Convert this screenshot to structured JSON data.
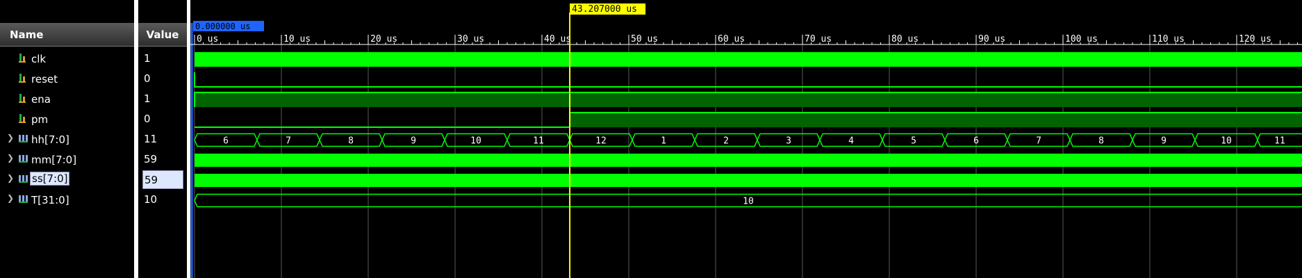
{
  "header": {
    "name": "Name",
    "value": "Value"
  },
  "signals": [
    {
      "name": "clk",
      "value": "1",
      "bus": false,
      "expandable": false,
      "selected": false
    },
    {
      "name": "reset",
      "value": "0",
      "bus": false,
      "expandable": false,
      "selected": false
    },
    {
      "name": "ena",
      "value": "1",
      "bus": false,
      "expandable": false,
      "selected": false
    },
    {
      "name": "pm",
      "value": "0",
      "bus": false,
      "expandable": false,
      "selected": false
    },
    {
      "name": "hh[7:0]",
      "value": "11",
      "bus": true,
      "expandable": true,
      "selected": false
    },
    {
      "name": "mm[7:0]",
      "value": "59",
      "bus": true,
      "expandable": true,
      "selected": false
    },
    {
      "name": "ss[7:0]",
      "value": "59",
      "bus": true,
      "expandable": true,
      "selected": true
    },
    {
      "name": "T[31:0]",
      "value": "10",
      "bus": true,
      "expandable": true,
      "selected": false
    }
  ],
  "cursor": {
    "label": "43.207000 us",
    "time_us": 43.207
  },
  "start_marker": {
    "label": "0.000000 us"
  },
  "timeline": {
    "start_us": 0,
    "end_us": 127.5,
    "major_step_us": 10,
    "ticks": [
      "0 us",
      "10 us",
      "20 us",
      "30 us",
      "40 us",
      "50 us",
      "60 us",
      "70 us",
      "80 us",
      "90 us",
      "100 us",
      "110 us",
      "120 us"
    ]
  },
  "hh_segments": [
    {
      "value": "6",
      "start_us": 0,
      "end_us": 7.2
    },
    {
      "value": "7",
      "start_us": 7.2,
      "end_us": 14.4
    },
    {
      "value": "8",
      "start_us": 14.4,
      "end_us": 21.6
    },
    {
      "value": "9",
      "start_us": 21.6,
      "end_us": 28.8
    },
    {
      "value": "10",
      "start_us": 28.8,
      "end_us": 36.0
    },
    {
      "value": "11",
      "start_us": 36.0,
      "end_us": 43.2
    },
    {
      "value": "12",
      "start_us": 43.2,
      "end_us": 50.4
    },
    {
      "value": "1",
      "start_us": 50.4,
      "end_us": 57.6
    },
    {
      "value": "2",
      "start_us": 57.6,
      "end_us": 64.8
    },
    {
      "value": "3",
      "start_us": 64.8,
      "end_us": 72.0
    },
    {
      "value": "4",
      "start_us": 72.0,
      "end_us": 79.2
    },
    {
      "value": "5",
      "start_us": 79.2,
      "end_us": 86.4
    },
    {
      "value": "6",
      "start_us": 86.4,
      "end_us": 93.6
    },
    {
      "value": "7",
      "start_us": 93.6,
      "end_us": 100.8
    },
    {
      "value": "8",
      "start_us": 100.8,
      "end_us": 108.0
    },
    {
      "value": "9",
      "start_us": 108.0,
      "end_us": 115.2
    },
    {
      "value": "10",
      "start_us": 115.2,
      "end_us": 122.4
    },
    {
      "value": "11",
      "start_us": 122.4,
      "end_us": 129.6
    }
  ],
  "T_segment": {
    "value": "10"
  },
  "colors": {
    "wave": "#00ff00",
    "high_fill": "#006400",
    "cursor": "#ffff00",
    "marker": "#1e64ff",
    "grid": "#5a5a5a"
  }
}
